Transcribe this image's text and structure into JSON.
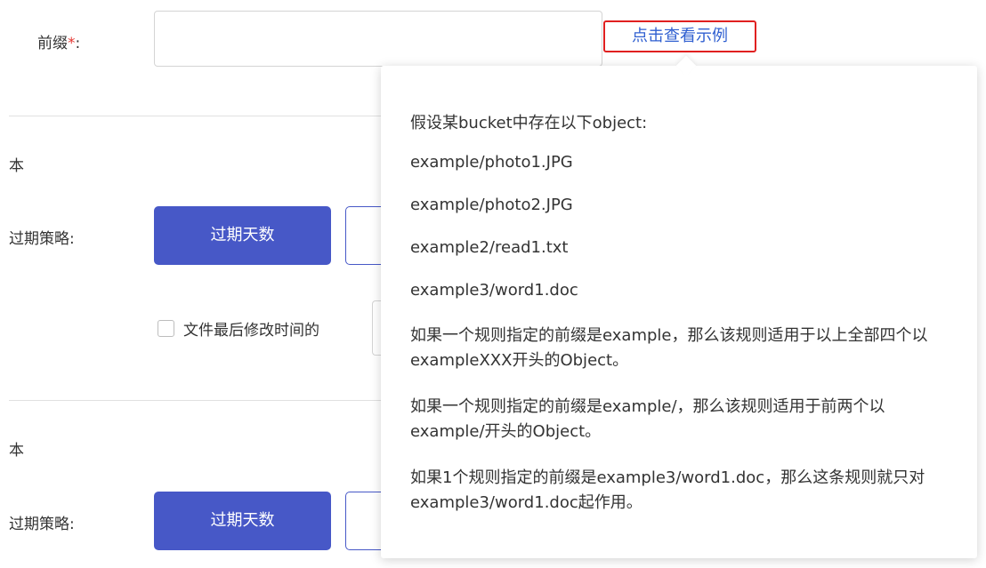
{
  "form": {
    "prefix_label": "前缀",
    "required_mark": "*",
    "label_colon": ":",
    "prefix_value": "",
    "example_link": "点击查看示例",
    "section1_partial": "本",
    "section1_policy_label": "过期策略:",
    "section1_btn_days": "过期天数",
    "checkbox_label": "文件最后修改时间的",
    "section2_partial": "本",
    "section2_policy_label": "过期策略:",
    "section2_btn_days": "过期天数"
  },
  "popover": {
    "intro": "假设某bucket中存在以下object:",
    "objects": [
      "example/photo1.JPG",
      "example/photo2.JPG",
      "example2/read1.txt",
      "example3/word1.doc"
    ],
    "explanations": [
      "如果一个规则指定的前缀是example，那么该规则适用于以上全部四个以exampleXXX开头的Object。",
      "如果一个规则指定的前缀是example/，那么该规则适用于前两个以example/开头的Object。",
      "如果1个规则指定的前缀是example3/word1.doc，那么这条规则就只对example3/word1.doc起作用。"
    ]
  },
  "colors": {
    "primary": "#4758c7",
    "link": "#2f5fd0",
    "highlight_border": "#e02020",
    "required": "#e53935"
  }
}
